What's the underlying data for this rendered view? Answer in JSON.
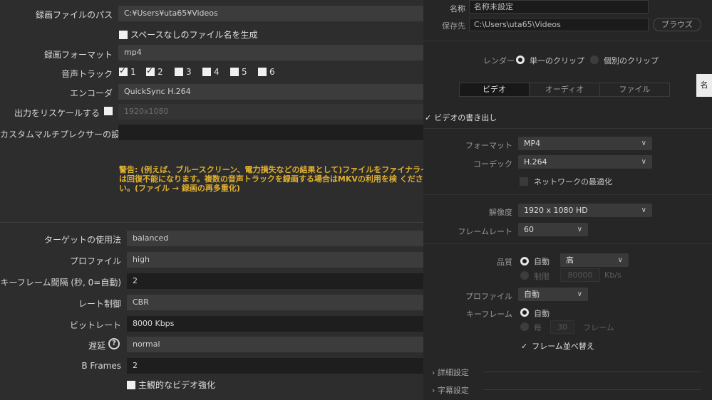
{
  "left": {
    "rec_path": {
      "label": "録画ファイルのパス",
      "value": "C:¥Users¥uta65¥Videos"
    },
    "no_space_filename": {
      "label": "スペースなしのファイル名を生成",
      "checked": false
    },
    "rec_format": {
      "label": "録画フォーマット",
      "value": "mp4"
    },
    "audio_tracks": {
      "label": "音声トラック",
      "tracks": [
        {
          "label": "1",
          "checked": true
        },
        {
          "label": "2",
          "checked": true
        },
        {
          "label": "3",
          "checked": false
        },
        {
          "label": "4",
          "checked": false
        },
        {
          "label": "5",
          "checked": false
        },
        {
          "label": "6",
          "checked": false
        }
      ]
    },
    "encoder": {
      "label": "エンコーダ",
      "value": "QuickSync H.264"
    },
    "rescale": {
      "label": "出力をリスケールする",
      "checked": false,
      "value": "1920x1080"
    },
    "custom_muxer": {
      "label": "カスタムマルチプレクサーの設定",
      "value": ""
    },
    "warning": "警告: (例えば、ブルースクリーン、電力損失などの結果として)ファイルをファイナライ は回復不能になります。複数の音声トラックを録画する場合はMKVの利用を検 ください。(ファイル → 録画の再多重化)",
    "target_usage": {
      "label": "ターゲットの使用法",
      "value": "balanced"
    },
    "profile": {
      "label": "プロファイル",
      "value": "high"
    },
    "keyframe_interval": {
      "label": "キーフレーム間隔 (秒, 0=自動)",
      "value": "2"
    },
    "rate_control": {
      "label": "レート制御",
      "value": "CBR"
    },
    "bitrate": {
      "label": "ビットレート",
      "value": "8000 Kbps"
    },
    "latency": {
      "label": "遅延",
      "value": "normal",
      "help_icon": "question-circle-icon"
    },
    "bframes": {
      "label": "B Frames",
      "value": "2"
    },
    "subjective_enhance": {
      "label": "主観的なビデオ強化",
      "checked": false
    }
  },
  "right": {
    "name": {
      "label": "名称",
      "value": "名称未設定"
    },
    "save_to": {
      "label": "保存先",
      "value": "C:\\Users\\uta65\\Videos",
      "browse_label": "ブラウズ"
    },
    "render": {
      "label": "レンダー",
      "single_clip": "単一のクリップ",
      "individual_clips": "個別のクリップ",
      "selected": "single_clip"
    },
    "tabs": [
      "ビデオ",
      "オーディオ",
      "ファイル"
    ],
    "active_tab": "ビデオ",
    "side_tab_label": "名",
    "export_video": {
      "label": "ビデオの書き出し",
      "checked": true
    },
    "format": {
      "label": "フォーマット",
      "value": "MP4"
    },
    "codec": {
      "label": "コーデック",
      "value": "H.264"
    },
    "network_optimize": {
      "label": "ネットワークの最適化",
      "checked": false
    },
    "resolution": {
      "label": "解像度",
      "value": "1920 x 1080 HD"
    },
    "frame_rate": {
      "label": "フレームレート",
      "value": "60"
    },
    "quality": {
      "label": "品質",
      "auto_label": "自動",
      "auto_value": "高",
      "limit_label": "制限",
      "limit_value": "80000",
      "limit_unit": "Kb/s",
      "selected": "auto"
    },
    "profile": {
      "label": "プロファイル",
      "value": "自動"
    },
    "keyframe": {
      "label": "キーフレーム",
      "auto_label": "自動",
      "every_label": "毎",
      "every_value": "30",
      "every_unit": "フレーム",
      "selected": "auto"
    },
    "frame_reorder": {
      "label": "フレーム並べ替え",
      "checked": true
    },
    "advanced_settings": "詳細設定",
    "subtitle_settings": "字幕設定"
  }
}
